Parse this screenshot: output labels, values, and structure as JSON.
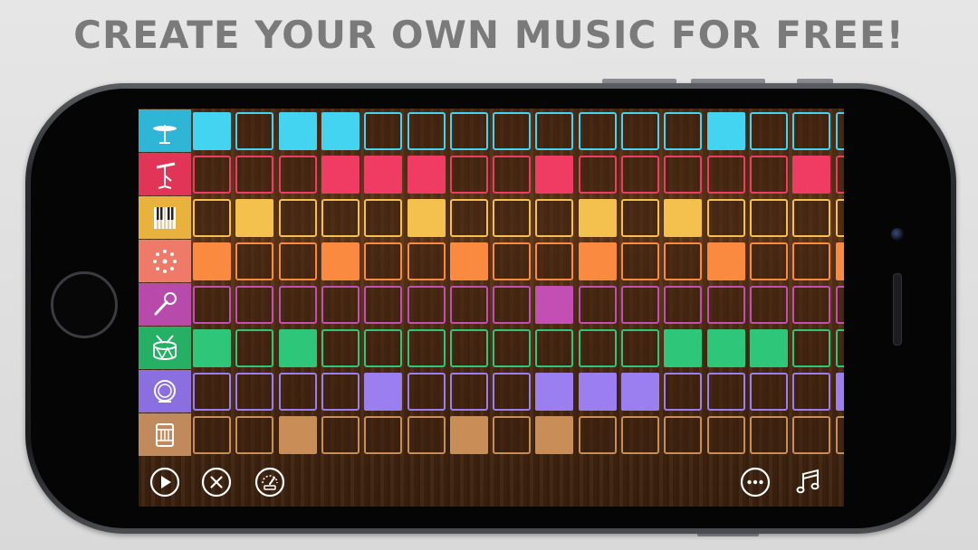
{
  "headline": "CREATE YOUR OWN MUSIC FOR FREE!",
  "tracks": [
    {
      "name": "cymbal",
      "icon": "cymbal-icon",
      "color": "#43d4f2",
      "tab_color": "#2fb6d6",
      "steps": [
        1,
        0,
        1,
        1,
        0,
        0,
        0,
        0,
        0,
        0,
        0,
        0,
        1,
        0,
        0,
        0
      ]
    },
    {
      "name": "hi-hat",
      "icon": "hihat-icon",
      "color": "#f03c63",
      "tab_color": "#e23456",
      "steps": [
        0,
        0,
        0,
        1,
        1,
        1,
        0,
        0,
        1,
        0,
        0,
        0,
        0,
        0,
        1,
        0
      ]
    },
    {
      "name": "piano",
      "icon": "piano-icon",
      "color": "#f4c04e",
      "tab_color": "#e9b23c",
      "steps": [
        0,
        1,
        0,
        0,
        0,
        1,
        0,
        0,
        0,
        1,
        0,
        1,
        0,
        0,
        0,
        0
      ]
    },
    {
      "name": "synth",
      "icon": "synth-icon",
      "color": "#fa8a40",
      "tab_color": "#f07a6a",
      "steps": [
        1,
        0,
        0,
        1,
        0,
        0,
        1,
        0,
        0,
        1,
        0,
        0,
        1,
        0,
        0,
        1
      ]
    },
    {
      "name": "vocal",
      "icon": "microphone-icon",
      "color": "#c34fb4",
      "tab_color": "#b84aab",
      "steps": [
        0,
        0,
        0,
        0,
        0,
        0,
        0,
        0,
        1,
        0,
        0,
        0,
        0,
        0,
        0,
        0
      ]
    },
    {
      "name": "snare",
      "icon": "snare-drum-icon",
      "color": "#2ec77a",
      "tab_color": "#25b066",
      "steps": [
        1,
        0,
        1,
        0,
        0,
        0,
        0,
        0,
        0,
        0,
        0,
        1,
        1,
        1,
        0,
        0
      ]
    },
    {
      "name": "tom",
      "icon": "tom-drum-icon",
      "color": "#9b7ef0",
      "tab_color": "#8b6fe0",
      "steps": [
        0,
        0,
        0,
        0,
        1,
        0,
        0,
        0,
        1,
        1,
        1,
        0,
        0,
        0,
        0,
        1
      ]
    },
    {
      "name": "bass-drum",
      "icon": "bass-drum-icon",
      "color": "#c98e58",
      "tab_color": "#c08a5c",
      "steps": [
        0,
        0,
        1,
        0,
        0,
        0,
        1,
        0,
        1,
        0,
        0,
        0,
        0,
        0,
        0,
        0
      ]
    }
  ],
  "controls": {
    "play": "play-icon",
    "clear": "clear-icon",
    "tempo": "tempo-icon",
    "more": "more-icon",
    "music": "music-note-icon"
  }
}
